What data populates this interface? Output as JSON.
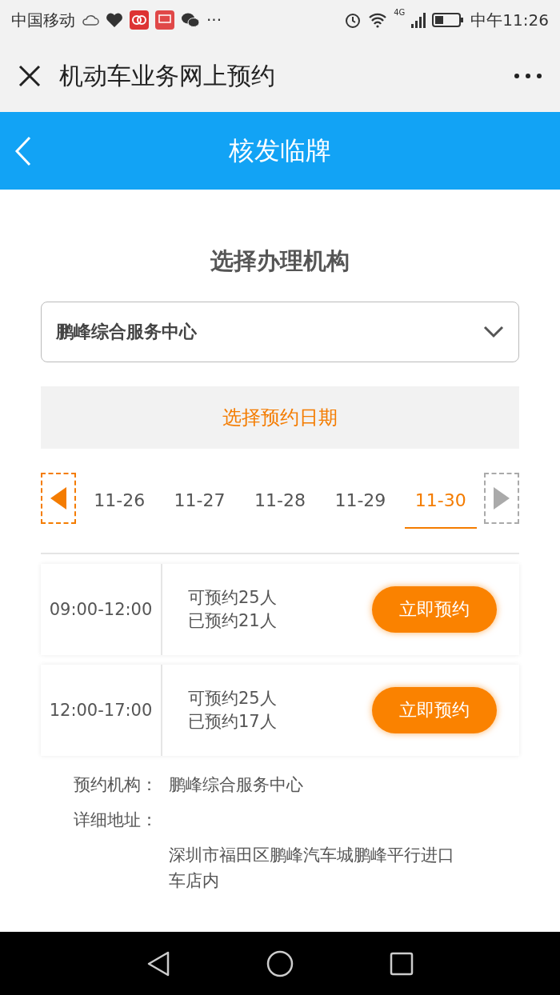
{
  "status_bar": {
    "carrier": "中国移动",
    "more": "···",
    "time": "中午11:26",
    "network": "4G"
  },
  "header": {
    "title": "机动车业务网上预约"
  },
  "nav_bar": {
    "title": "核发临牌"
  },
  "institution": {
    "heading": "选择办理机构",
    "value": "鹏峰综合服务中心"
  },
  "date_picker": {
    "heading": "选择预约日期",
    "prev_disabled": false,
    "next_disabled": true,
    "dates": [
      {
        "label": "11-26",
        "selected": false
      },
      {
        "label": "11-27",
        "selected": false
      },
      {
        "label": "11-28",
        "selected": false
      },
      {
        "label": "11-29",
        "selected": false
      },
      {
        "label": "11-30",
        "selected": true
      }
    ]
  },
  "slots": [
    {
      "time": "09:00-12:00",
      "available": "可预约25人",
      "booked": "已预约21人",
      "button": "立即预约"
    },
    {
      "time": "12:00-17:00",
      "available": "可预约25人",
      "booked": "已预约17人",
      "button": "立即预约"
    }
  ],
  "details": [
    {
      "label": "预约机构：",
      "value": "鹏峰综合服务中心"
    },
    {
      "label": "详细地址：",
      "value": "深圳市福田区鹏峰汽车城鹏峰平行进口车店内"
    }
  ]
}
